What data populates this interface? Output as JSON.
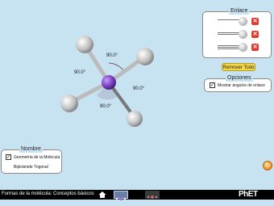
{
  "bonds_panel": {
    "title": "Enlace",
    "remove_all_label": "Remover Todo"
  },
  "options_panel": {
    "title": "Opciones",
    "show_angles_label": "Mostrar ángulos de enlace",
    "show_angles_checked": true
  },
  "name_panel": {
    "title": "Nombre",
    "geometry_label": "Geometría de la Molécula",
    "geometry_checked": true,
    "geometry_value": "Bipirámide Trigonal"
  },
  "angles": [
    "90.0°",
    "90.0°",
    "90.0°",
    "90.0°"
  ],
  "bottom_bar": {
    "title": "Formas de la molécula: Conceptos básicos",
    "brand": "PhET"
  },
  "colors": {
    "background": "#c7e3f2",
    "central_atom": "#7b3fc2",
    "remove_button": "#f5d94a"
  }
}
